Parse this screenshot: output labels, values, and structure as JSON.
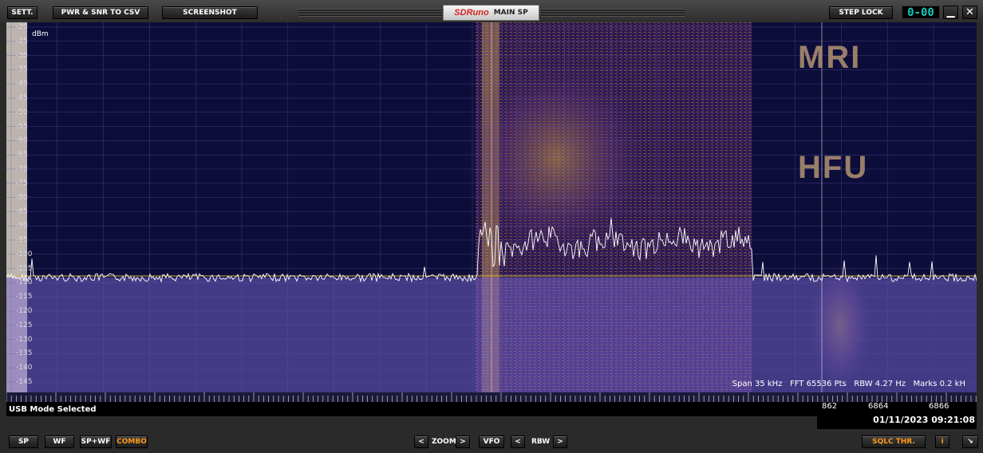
{
  "toolbar": {
    "settings": "SETT.",
    "pwr_snr_csv": "PWR & SNR TO CSV",
    "screenshot": "SCREENSHOT",
    "step_lock": "STEP LOCK",
    "vfo_digits": "0-00"
  },
  "window": {
    "logo": "SDRuno",
    "title": "MAIN SP",
    "minimize": "▁",
    "close": "✕"
  },
  "spectrum": {
    "unit": "dBm",
    "y_ticks": [
      "-20",
      "-25",
      "-30",
      "-35",
      "-40",
      "-45",
      "-50",
      "-55",
      "-60",
      "-65",
      "-70",
      "-75",
      "-80",
      "-85",
      "-90",
      "-95",
      "-100",
      "-105",
      "-110",
      "-115",
      "-120",
      "-125",
      "-130",
      "-135",
      "-140",
      "-145"
    ],
    "info": "Span 35 kHz   FFT 65536 Pts   RBW 4.27 Hz   Marks 0.2 kH",
    "watermark": [
      "MRI",
      "HFU"
    ],
    "freq_labels": [
      "862",
      "6864",
      "6866"
    ]
  },
  "status": {
    "mode": "USB Mode Selected",
    "datetime": "01/11/2023 09:21:08"
  },
  "bottombar": {
    "sp": "SP",
    "wf": "WF",
    "sp_wf": "SP+WF",
    "combo": "COMBO",
    "zoom_left": "<",
    "zoom": "ZOOM",
    "zoom_right": ">",
    "vfo": "VFO",
    "rbw_left": "<",
    "rbw": "RBW",
    "rbw_right": ">",
    "sqlc": "SQLC THR.",
    "info": "i",
    "resize": "↘"
  },
  "colors": {
    "background": "#0d0d3a",
    "trace": "#ffffff",
    "threshold": "#d4b24a",
    "accent": "#ff9a1a"
  }
}
